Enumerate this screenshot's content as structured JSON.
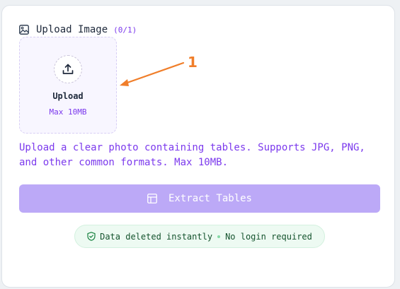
{
  "upload_section": {
    "title": "Upload Image",
    "count": "(0/1)",
    "dropzone": {
      "label": "Upload",
      "limit": "Max 10MB"
    },
    "annotation_number": "1"
  },
  "description": "Upload a clear photo containing tables. Supports JPG, PNG, and other common formats. Max 10MB.",
  "extract_button": {
    "label": "Extract Tables"
  },
  "privacy_badge": {
    "left_text": "Data deleted instantly",
    "right_text": "No login required"
  },
  "colors": {
    "accent": "#7c3aed",
    "button_bg": "#bca9f7",
    "annotation": "#f07e2a",
    "badge_bg": "#edfaf2"
  },
  "icons": {
    "header": "image-icon",
    "dropzone": "upload-icon",
    "button": "table-icon",
    "badge": "shield-check-icon"
  }
}
